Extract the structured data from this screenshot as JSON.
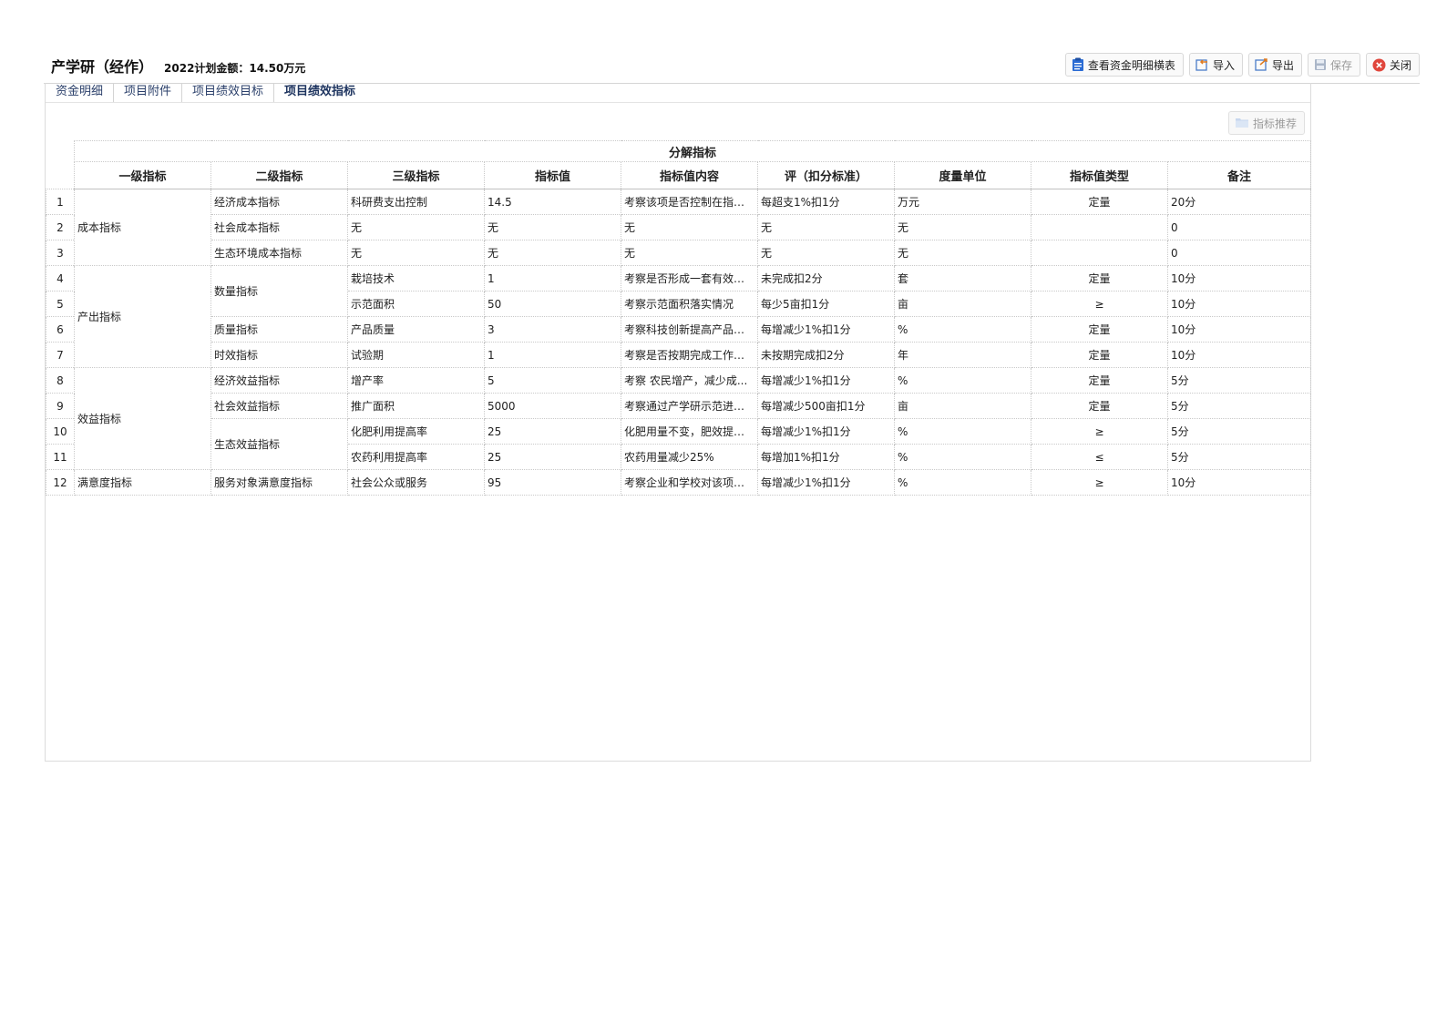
{
  "header": {
    "title": "产学研（经作）",
    "amount": "2022计划金额：14.50万元"
  },
  "toolbar": {
    "view_details": "查看资金明细横表",
    "import": "导入",
    "export": "导出",
    "save": "保存",
    "close": "关闭"
  },
  "tabs": [
    {
      "label": "资金明细"
    },
    {
      "label": "项目附件"
    },
    {
      "label": "项目绩效目标"
    },
    {
      "label": "项目绩效指标",
      "active": true
    }
  ],
  "recommend_label": "指标推荐",
  "table": {
    "group_header": "分解指标",
    "columns": [
      "一级指标",
      "二级指标",
      "三级指标",
      "指标值",
      "指标值内容",
      "评（扣分标准）",
      "度量单位",
      "指标值类型",
      "备注"
    ],
    "rows": [
      {
        "idx": "1",
        "l1": "成本指标",
        "l2": "经济成本指标",
        "l3": "科研费支出控制",
        "value": "14.5",
        "content": "考察该项是否控制在指标...",
        "score": "每超支1%扣1分",
        "unit": "万元",
        "type": "定量",
        "note": "20分"
      },
      {
        "idx": "2",
        "l1": "成本指标",
        "l2": "社会成本指标",
        "l3": "无",
        "value": "无",
        "content": "无",
        "score": "无",
        "unit": "无",
        "type": "",
        "note": "0"
      },
      {
        "idx": "3",
        "l1": "成本指标",
        "l2": "生态环境成本指标",
        "l3": "无",
        "value": "无",
        "content": "无",
        "score": "无",
        "unit": "无",
        "type": "",
        "note": "0"
      },
      {
        "idx": "4",
        "l1": "产出指标",
        "l2": "数量指标",
        "l3": "栽培技术",
        "value": "1",
        "content": "考察是否形成一套有效的...",
        "score": "未完成扣2分",
        "unit": "套",
        "type": "定量",
        "note": "10分"
      },
      {
        "idx": "5",
        "l1": "产出指标",
        "l2": "数量指标",
        "l3": "示范面积",
        "value": "50",
        "content": "考察示范面积落实情况",
        "score": "每少5亩扣1分",
        "unit": "亩",
        "type": "≥",
        "note": "10分"
      },
      {
        "idx": "6",
        "l1": "产出指标",
        "l2": "质量指标",
        "l3": "产品质量",
        "value": "3",
        "content": "考察科技创新提高产品质...",
        "score": "每增减少1%扣1分",
        "unit": "%",
        "type": "定量",
        "note": "10分"
      },
      {
        "idx": "7",
        "l1": "产出指标",
        "l2": "时效指标",
        "l3": "试验期",
        "value": "1",
        "content": "考察是否按期完成工作任...",
        "score": "未按期完成扣2分",
        "unit": "年",
        "type": "定量",
        "note": "10分"
      },
      {
        "idx": "8",
        "l1": "效益指标",
        "l2": "经济效益指标",
        "l3": "增产率",
        "value": "5",
        "content": "考察 农民增产，减少成...",
        "score": "每增减少1%扣1分",
        "unit": "%",
        "type": "定量",
        "note": "5分"
      },
      {
        "idx": "9",
        "l1": "效益指标",
        "l2": "社会效益指标",
        "l3": "推广面积",
        "value": "5000",
        "content": "考察通过产学研示范进而...",
        "score": "每增减少500亩扣1分",
        "unit": "亩",
        "type": "定量",
        "note": "5分"
      },
      {
        "idx": "10",
        "l1": "效益指标",
        "l2": "生态效益指标",
        "l3": "化肥利用提高率",
        "value": "25",
        "content": "化肥用量不变，肥效提高...",
        "score": "每增减少1%扣1分",
        "unit": "%",
        "type": "≥",
        "note": "5分"
      },
      {
        "idx": "11",
        "l1": "效益指标",
        "l2": "生态效益指标",
        "l3": "农药利用提高率",
        "value": "25",
        "content": "农药用量减少25%",
        "score": "每增加1%扣1分",
        "unit": "%",
        "type": "≤",
        "note": "5分"
      },
      {
        "idx": "12",
        "l1": "满意度指标",
        "l2": "服务对象满意度指标",
        "l3": "社会公众或服务",
        "value": "95",
        "content": "考察企业和学校对该项目...",
        "score": "每增减少1%扣1分",
        "unit": "%",
        "type": "≥",
        "note": "10分"
      }
    ]
  }
}
